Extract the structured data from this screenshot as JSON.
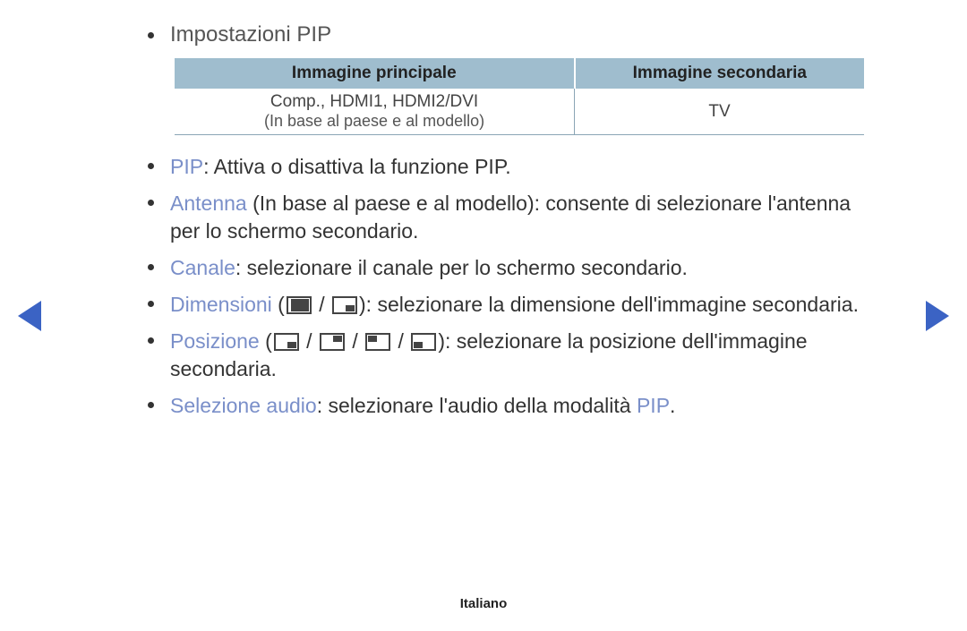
{
  "title": "Impostazioni PIP",
  "table": {
    "headers": [
      "Immagine principale",
      "Immagine secondaria"
    ],
    "row": {
      "main_line1": "Comp., HDMI1, HDMI2/DVI",
      "main_line2": "(In base al paese e al modello)",
      "secondary": "TV"
    }
  },
  "items": {
    "pip": {
      "kw": "PIP",
      "text": ": Attiva o disattiva la funzione PIP."
    },
    "antenna": {
      "kw": "Antenna",
      "note": " (In base al paese e al modello)",
      "text": ": consente di selezionare l'antenna per lo schermo secondario."
    },
    "canale": {
      "kw": "Canale",
      "text": ": selezionare il canale per lo schermo secondario."
    },
    "dimensioni": {
      "kw": "Dimensioni",
      "text_after": "): selezionare la dimensione dell'immagine secondaria."
    },
    "posizione": {
      "kw": "Posizione",
      "text_after": "): selezionare la posizione dell'immagine secondaria."
    },
    "audio": {
      "kw": "Selezione audio",
      "text": ": selezionare l'audio della modalità ",
      "kw2": "PIP",
      "tail": "."
    }
  },
  "sep": " / ",
  "open_paren": " (",
  "footer": "Italiano"
}
